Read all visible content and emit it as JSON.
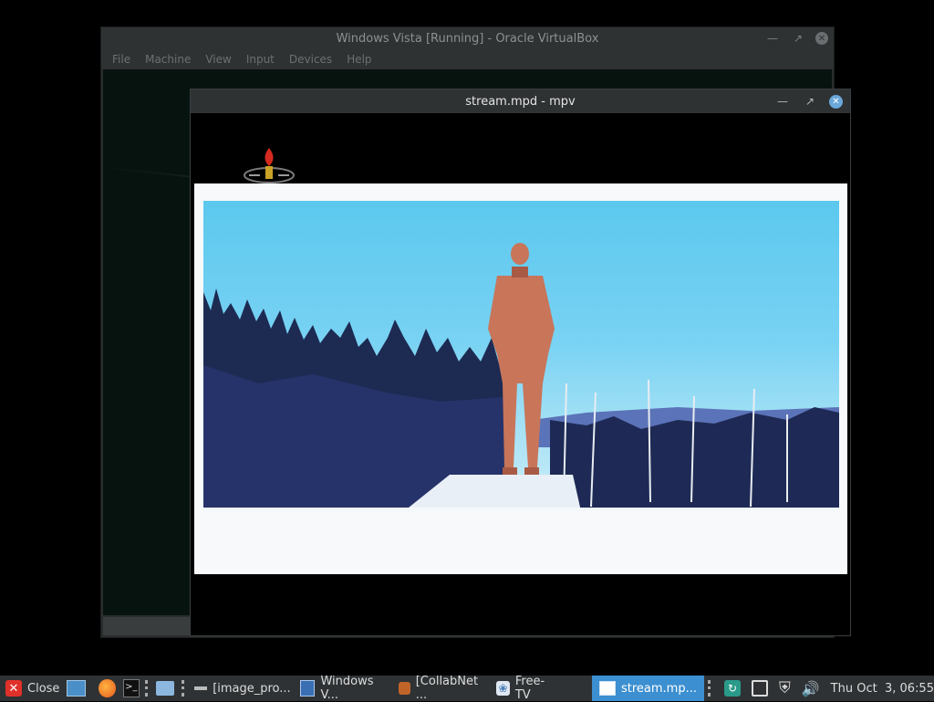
{
  "vbox": {
    "title": "Windows Vista [Running] - Oracle VirtualBox",
    "menu": [
      "File",
      "Machine",
      "View",
      "Input",
      "Devices",
      "Help"
    ]
  },
  "mpv": {
    "title": "stream.mpd - mpv"
  },
  "taskbar": {
    "close_label": "Close",
    "tasks": [
      {
        "label": "[image_pro...",
        "icon": "window-icon"
      },
      {
        "label": "Windows V...",
        "icon": "virtualbox-icon"
      },
      {
        "label": "[CollabNet ...",
        "icon": "app-icon"
      },
      {
        "label": "Free-TV",
        "icon": "tv-icon"
      },
      {
        "label": "stream.mp...",
        "icon": "mpv-icon",
        "active": true
      }
    ],
    "clock": "Thu Oct  3, 06:55"
  },
  "colors": {
    "taskbar_bg": "#2f3234",
    "active_task": "#3c8fd0",
    "close_red": "#e0302a"
  }
}
